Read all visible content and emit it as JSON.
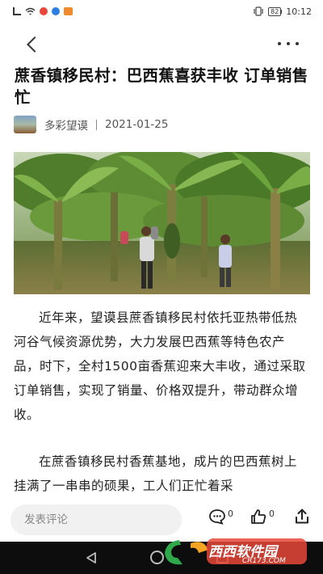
{
  "status_bar": {
    "time": "10:12",
    "battery": "82"
  },
  "article": {
    "title": "蔗香镇移民村：巴西蕉喜获丰收 订单销售忙",
    "source": "多彩望谟",
    "date": "2021-01-25",
    "paragraphs": [
      "近年来，望谟县蔗香镇移民村依托亚热带低热河谷气候资源优势，大力发展巴西蕉等特色农产品，时下，全村1500亩香蕉迎来大丰收，通过采取订单销售，实现了销量、价格双提升，带动群众增收。",
      "在蔗香镇移民村香蕉基地，成片的巴西蕉树上挂满了一串串的硕果，工人们正忙着采"
    ]
  },
  "bottom_bar": {
    "comment_placeholder": "发表评论",
    "comment_count": "0",
    "like_count": "0"
  },
  "watermark": {
    "text": "西西软件园",
    "sub": "CR173.COM"
  },
  "icons": {
    "back": "back-arrow-icon",
    "more": "more-dots-icon",
    "comment": "comment-bubble-icon",
    "like": "thumbs-up-icon",
    "share": "share-icon"
  }
}
